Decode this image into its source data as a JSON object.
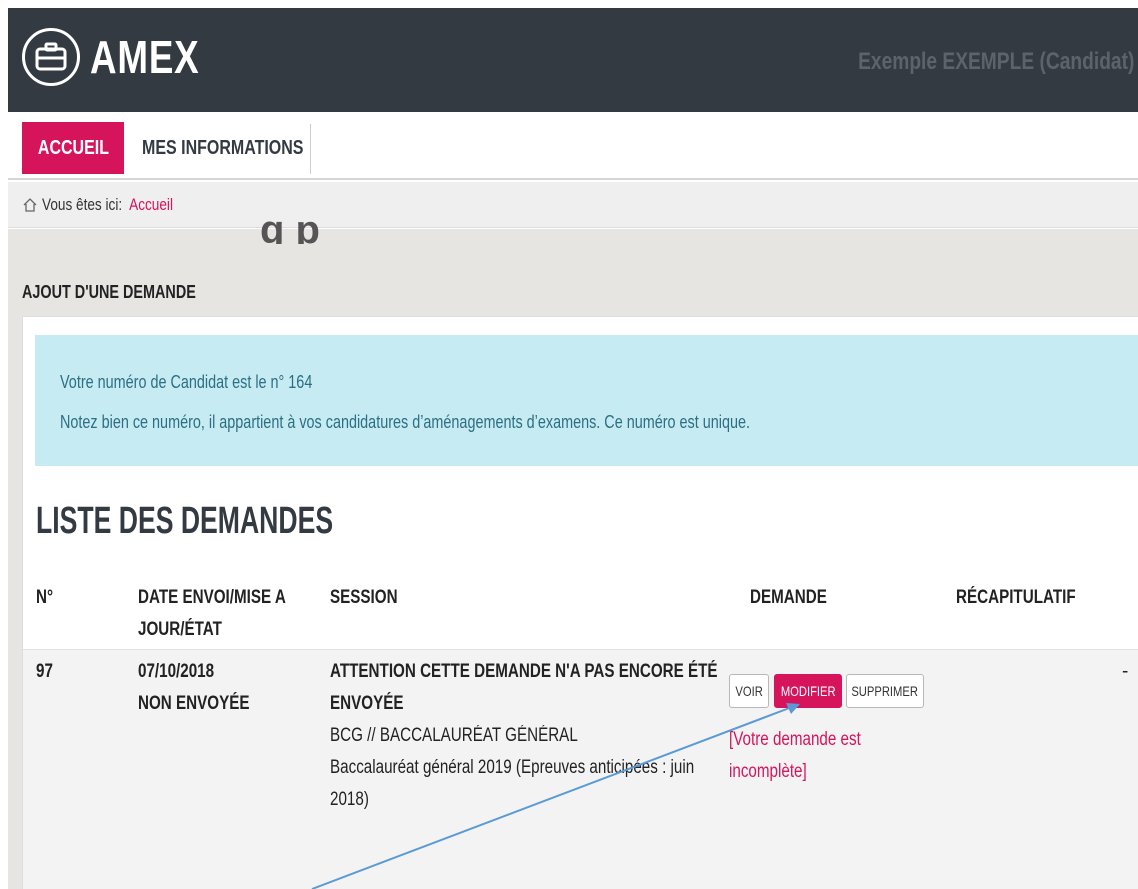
{
  "header": {
    "app_title": "AMEX",
    "user_name": "Exemple EXEMPLE (Candidat)",
    "logo_icon": "briefcase-icon"
  },
  "nav": {
    "tabs": [
      {
        "label": "ACCUEIL",
        "active": true
      },
      {
        "label": "MES INFORMATIONS",
        "active": false
      }
    ]
  },
  "breadcrumb": {
    "prefix": "Vous êtes ici:",
    "current": "Accueil",
    "icon": "home-icon"
  },
  "section": {
    "heading": "AJOUT D'UNE DEMANDE",
    "ghost_text": "g   p"
  },
  "info": {
    "line1": "Votre numéro de Candidat est le n° 164",
    "line2": "Notez bien ce numéro, il appartient à vos candidatures d’aménagements d’examens. Ce numéro est unique."
  },
  "list": {
    "title": "LISTE DES DEMANDES",
    "headers": {
      "num": "N°",
      "date_line1": "DATE ENVOI/MISE A",
      "date_line2": "JOUR/ÉTAT",
      "session": "SESSION",
      "demande": "DEMANDE",
      "recap": "RÉCAPITULATIF"
    },
    "rows": [
      {
        "num": "97",
        "date": "07/10/2018",
        "status": "NON ENVOYÉE",
        "warning_line1": "ATTENTION CETTE DEMANDE N'A PAS ENCORE ÉTÉ",
        "warning_line2": "ENVOYÉE",
        "exam": "BCG // BACCALAURÉAT GÉNÉRAL",
        "session_line1": "Baccalauréat général 2019 (Epreuves anticipées : juin",
        "session_line2": "2018)",
        "buttons": {
          "voir": "VOIR",
          "modifier": "MODIFIER",
          "supprimer": "SUPPRIMER"
        },
        "incomplete_line1": "[Votre demande est",
        "incomplete_line2": "incomplète]",
        "recap": "-"
      }
    ]
  },
  "colors": {
    "accent": "#d6145c",
    "header_bg": "#333a42",
    "info_bg": "#c6ebf3",
    "annotation_arrow": "#5b9bd5"
  }
}
